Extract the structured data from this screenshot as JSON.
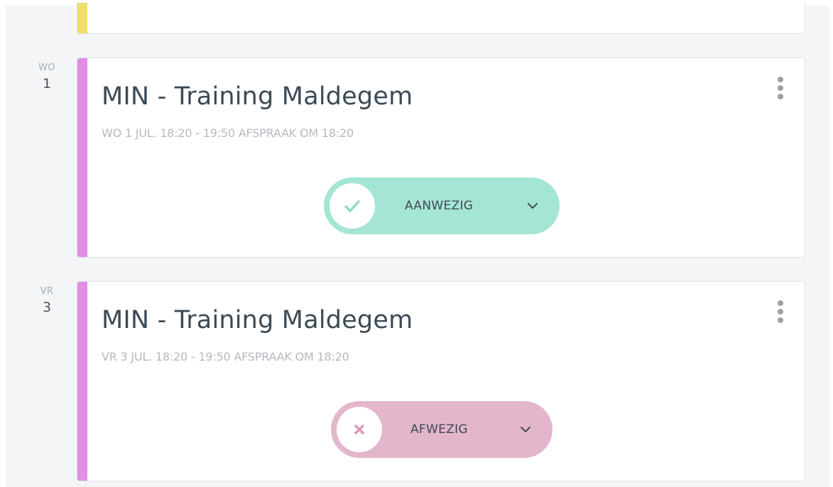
{
  "events": [
    {
      "day_of_week": "WO",
      "day_number": "1",
      "title": "MIN - Training Maldegem",
      "subtitle": "WO 1 JUL. 18:20 - 19:50 AFSPRAAK OM 18:20",
      "status_label": "AANWEZIG",
      "status_icon": "check-icon",
      "status_color": "#a5e5d5",
      "accent_color": "#e08ee6"
    },
    {
      "day_of_week": "VR",
      "day_number": "3",
      "title": "MIN - Training Maldegem",
      "subtitle": "VR 3 JUL. 18:20 - 19:50 AFSPRAAK OM 18:20",
      "status_label": "AFWEZIG",
      "status_icon": "close-icon",
      "status_color": "#e4b6cb",
      "accent_color": "#e08ee6"
    }
  ],
  "previous_card_accent_color": "#f0dd6a"
}
